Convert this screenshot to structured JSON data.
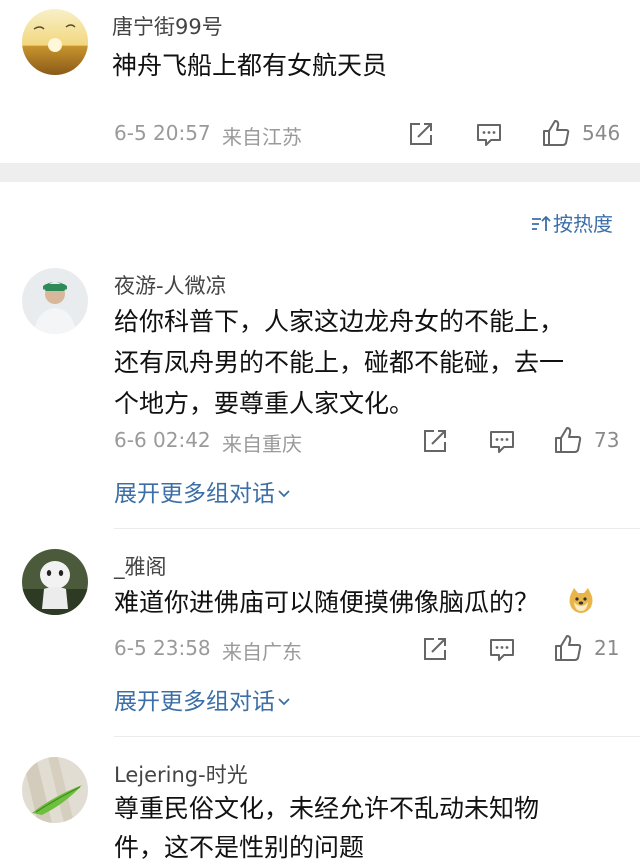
{
  "top_comment": {
    "username": "唐宁街99号",
    "text": "神舟飞船上都有女航天员",
    "time": "6-5 20:57",
    "location": "来自江苏",
    "likes": "546"
  },
  "sort": {
    "label": "按热度"
  },
  "replies": [
    {
      "username": "夜游-人微凉",
      "lines": [
        "给你科普下，人家这边龙舟女的不能上，",
        "还有凤舟男的不能上，碰都不能碰，去一",
        "个地方，要尊重人家文化。"
      ],
      "time": "6-6 02:42",
      "location": "来自重庆",
      "likes": "73",
      "expand": "展开更多组对话"
    },
    {
      "username": "_雅阁",
      "lines": [
        "难道你进佛庙可以随便摸佛像脑瓜的？"
      ],
      "time": "6-5 23:58",
      "location": "来自广东",
      "likes": "21",
      "expand": "展开更多组对话"
    },
    {
      "username": "Lejering-时光",
      "lines": [
        "尊重民俗文化，未经允许不乱动未知物",
        "件，这不是性别的问题"
      ]
    }
  ],
  "colors": {
    "link_blue": "#3c6fa8",
    "meta_gray": "#9a9a9a",
    "separator_gray": "#eeeeee"
  }
}
